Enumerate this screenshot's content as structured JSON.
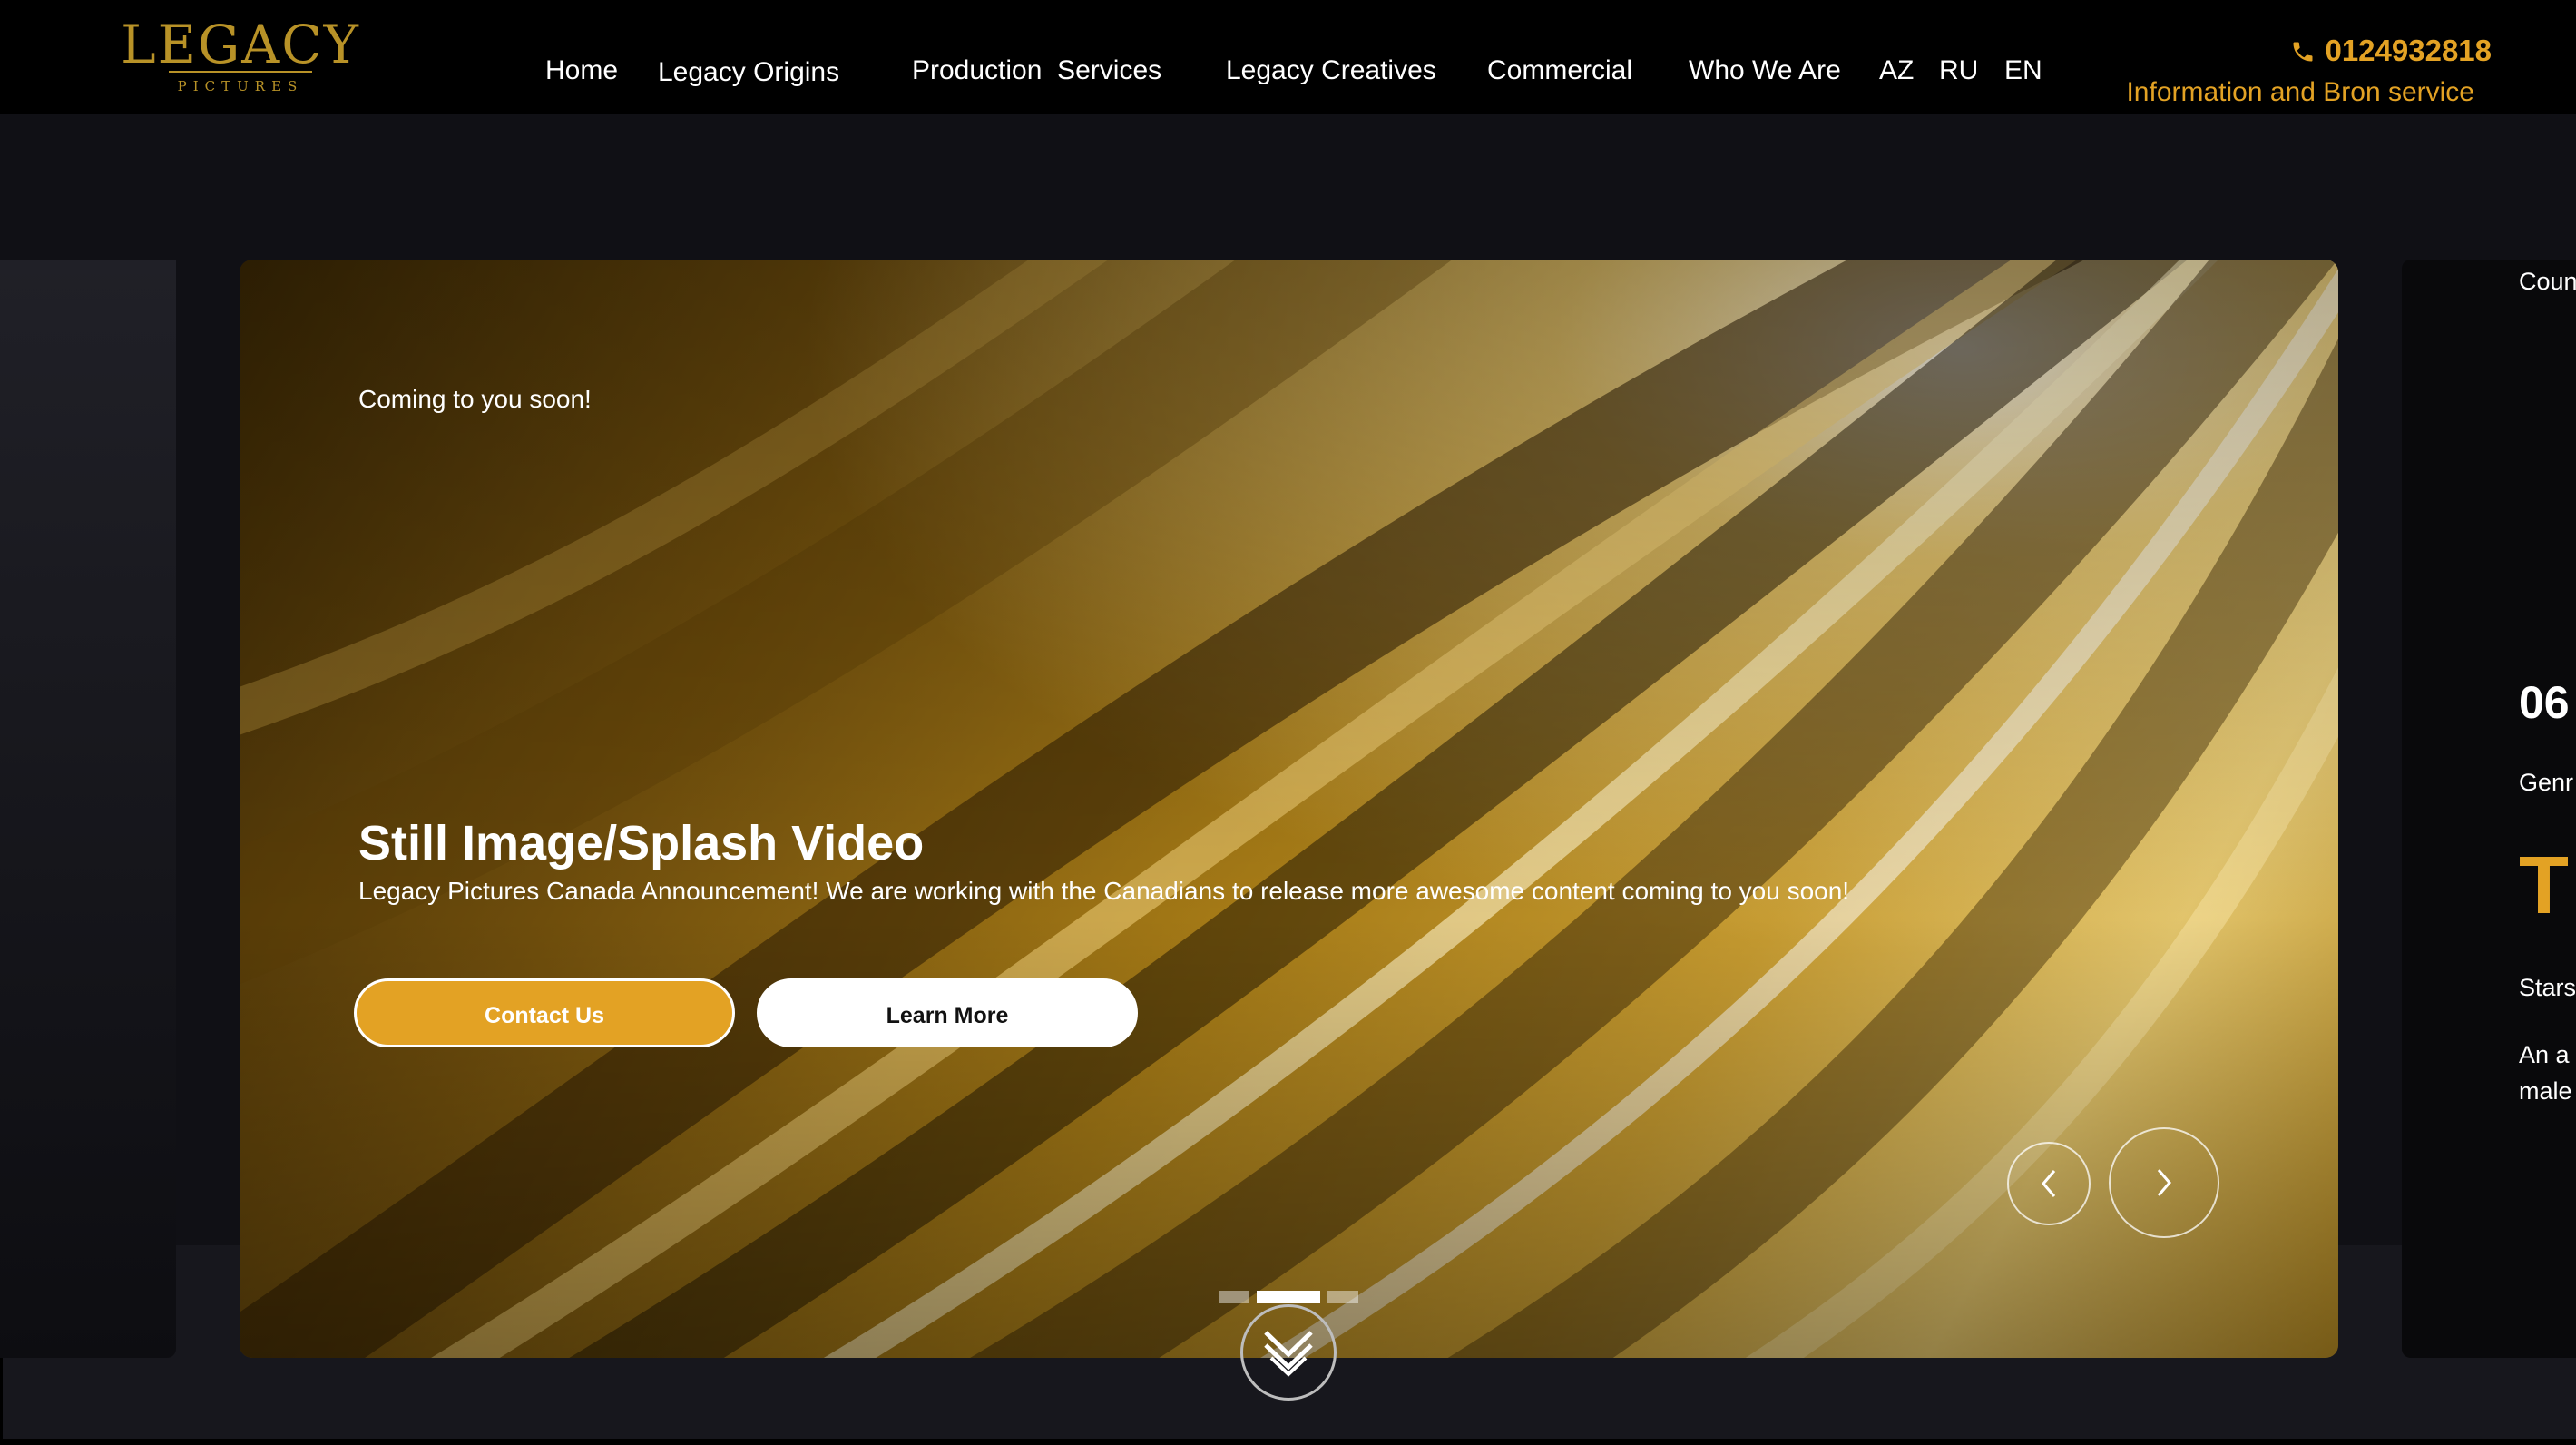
{
  "logo": {
    "word": "LEGACY",
    "sub": "PICTURES"
  },
  "nav": {
    "home": "Home",
    "origins": "Legacy Origins",
    "production": "Production  Services",
    "creatives": "Legacy Creatives",
    "commercial": "Commercial",
    "who": "Who We Are",
    "lang_az": "AZ",
    "lang_ru": "RU",
    "lang_en": "EN"
  },
  "contact": {
    "phone": "0124932818",
    "service": "Information and Bron service",
    "phone_icon": "phone-icon"
  },
  "slide": {
    "kicker": "Coming to you soon!",
    "title": "Still Image/Splash Video",
    "description": "Legacy Pictures Canada Announcement! We are working with the Canadians to release more awesome content coming to you soon!",
    "contact_button": "Contact Us",
    "learn_button": "Learn More",
    "prev_icon": "chevron-left-icon",
    "next_icon": "chevron-right-icon",
    "dots_total": 3,
    "dots_active": 2
  },
  "next_slide_peek": {
    "line1": "Coun",
    "number": "06",
    "line2": "Genr",
    "big_letter": "T",
    "line3": "Stars",
    "line4": "An a",
    "line5": "male"
  },
  "scroll_icon": "double-chevron-down-icon",
  "colors": {
    "accent": "#e3a224",
    "logo_gold": "#b89227",
    "header_bg": "#000000",
    "page_bg": "#17171d"
  }
}
